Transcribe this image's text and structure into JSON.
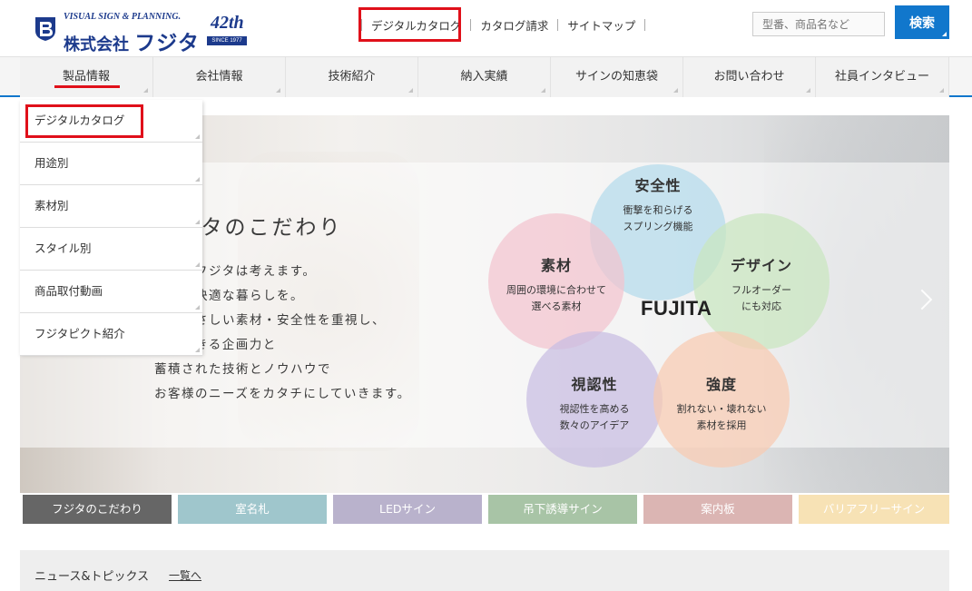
{
  "header": {
    "logo_tagline": "VISUAL SIGN & PLANNING.",
    "logo_company_prefix": "株式会社",
    "logo_company_name": "フジタ",
    "anniversary_number": "42th",
    "anniversary_since": "SINCE 1977",
    "top_links": [
      "デジタルカタログ",
      "カタログ請求",
      "サイトマップ"
    ],
    "search_placeholder": "型番、商品名など",
    "search_button": "検索"
  },
  "nav": {
    "items": [
      "製品情報",
      "会社情報",
      "技術紹介",
      "納入実績",
      "サインの知恵袋",
      "お問い合わせ",
      "社員インタビュー"
    ]
  },
  "dropdown": {
    "items": [
      "デジタルカタログ",
      "用途別",
      "素材別",
      "スタイル別",
      "商品取付動画",
      "フジタピクト紹介"
    ]
  },
  "hero": {
    "title": "フジタのこだわり",
    "lines": [
      "私たちフジタは考えます。",
      "皆様の快適な暮らしを。",
      "人にやさしい素材・安全性を重視し、",
      "信頼できる企画力と",
      "蓄積された技術とノウハウで",
      "お客様のニーズをカタチにしていきます。"
    ],
    "center": "FUJITA",
    "petals": [
      {
        "heading": "安全性",
        "desc1": "衝撃を和らげる",
        "desc2": "スプリング機能",
        "color": "#b9dcec"
      },
      {
        "heading": "素材",
        "desc1": "周囲の環境に合わせて",
        "desc2": "選べる素材",
        "color": "#f2c4cf"
      },
      {
        "heading": "デザイン",
        "desc1": "フルオーダー",
        "desc2": "にも対応",
        "color": "#c9e6bf"
      },
      {
        "heading": "視認性",
        "desc1": "視認性を高める",
        "desc2": "数々のアイデア",
        "color": "#c8bde2"
      },
      {
        "heading": "強度",
        "desc1": "割れない・壊れない",
        "desc2": "素材を採用",
        "color": "#f8cbb1"
      }
    ]
  },
  "tabs": [
    {
      "label": "フジタのこだわり",
      "color": "#666666"
    },
    {
      "label": "室名札",
      "color": "#9fc6cc"
    },
    {
      "label": "LEDサイン",
      "color": "#b9b2cc"
    },
    {
      "label": "吊下誘導サイン",
      "color": "#a8c4a6"
    },
    {
      "label": "案内板",
      "color": "#dbb5b3"
    },
    {
      "label": "バリアフリーサイン",
      "color": "#f7e2b5"
    }
  ],
  "news": {
    "title": "ニュース&トピックス",
    "more": "一覧へ"
  },
  "colors": {
    "brand_blue": "#1177cc",
    "logo_navy": "#1c3a8c",
    "highlight_red": "#e0101a"
  }
}
